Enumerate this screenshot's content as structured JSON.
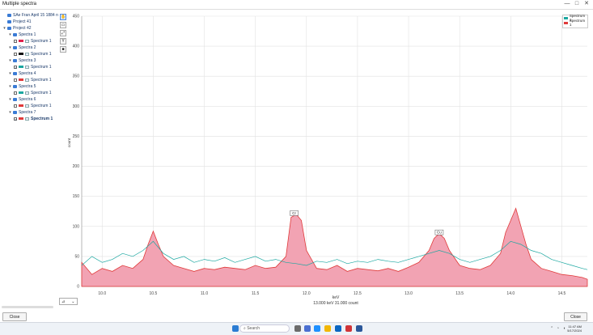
{
  "window": {
    "title": "Multiple spectra",
    "min": "—",
    "max": "□",
    "close": "✕"
  },
  "tree": [
    {
      "label": "SAe Fran April 15 1884 n",
      "level": 0,
      "type": "folder",
      "expander": ""
    },
    {
      "label": "Project 41",
      "level": 0,
      "type": "folder",
      "expander": ""
    },
    {
      "label": "Project 42",
      "level": 0,
      "type": "folder",
      "expander": "▾"
    },
    {
      "label": "Spectra 1",
      "level": 1,
      "type": "folder",
      "expander": "▾"
    },
    {
      "label": "Spectrum 1",
      "level": 2,
      "type": "spectrum",
      "checked": false,
      "color": "#e0204a"
    },
    {
      "label": "Spectra 2",
      "level": 1,
      "type": "folder",
      "expander": "▾"
    },
    {
      "label": "Spectrum 1",
      "level": 2,
      "type": "spectrum",
      "checked": false,
      "color": "#111111"
    },
    {
      "label": "Spectra 3",
      "level": 1,
      "type": "folder",
      "expander": "▾"
    },
    {
      "label": "Spectrum 1",
      "level": 2,
      "type": "spectrum",
      "checked": true,
      "color": "#1aa7a0"
    },
    {
      "label": "Spectra 4",
      "level": 1,
      "type": "folder",
      "expander": "▾"
    },
    {
      "label": "Spectrum 1",
      "level": 2,
      "type": "spectrum",
      "checked": false,
      "color": "#e03a3a"
    },
    {
      "label": "Spectra 5",
      "level": 1,
      "type": "folder",
      "expander": "▾"
    },
    {
      "label": "Spectrum 1",
      "level": 2,
      "type": "spectrum",
      "checked": false,
      "color": "#1aa7a0"
    },
    {
      "label": "Spectra 6",
      "level": 1,
      "type": "folder",
      "expander": "▾"
    },
    {
      "label": "Spectrum 1",
      "level": 2,
      "type": "spectrum",
      "checked": false,
      "color": "#e03a3a"
    },
    {
      "label": "Spectra 7",
      "level": 1,
      "type": "folder",
      "expander": "▾"
    },
    {
      "label": "Spectrum 1",
      "level": 2,
      "type": "spectrum",
      "checked": true,
      "color": "#e03a3a",
      "bold": true
    }
  ],
  "buttons": {
    "close_left": "Close",
    "close_right": "Close"
  },
  "tools": [
    "hand-icon",
    "zoom-box-icon",
    "zoom-fit-icon",
    "label-icon",
    "screenshot-icon"
  ],
  "plot": {
    "xlabel": "keV",
    "ylabel": "count",
    "readout": "13.000 keV  31.000 count",
    "legend": [
      {
        "name": "Spectrum 1",
        "color": "#1aa7a0"
      },
      {
        "name": "Spectrum 1",
        "color": "#e03a3a"
      }
    ],
    "peak_labels": [
      {
        "text": "Cr",
        "x": 11.88,
        "y": 118
      },
      {
        "text": "Cu",
        "x": 13.3,
        "y": 86
      }
    ]
  },
  "chart_data": {
    "type": "area",
    "xlabel": "keV",
    "ylabel": "count",
    "xlim": [
      9.8,
      14.75
    ],
    "ylim": [
      0,
      450
    ],
    "xticks": [
      10.0,
      10.5,
      11.0,
      11.5,
      12.0,
      12.5,
      13.0,
      13.5,
      14.0,
      14.5
    ],
    "xtick_labels": [
      "10.0",
      "10.5",
      "11.0",
      "11.5",
      "12.0",
      "12.5",
      "13.0",
      "13.5",
      "14.0",
      "14.5"
    ],
    "yticks": [
      0,
      50,
      100,
      150,
      200,
      250,
      300,
      350,
      400,
      450
    ],
    "ytick_labels": [
      "0",
      "50",
      "100",
      "150",
      "200",
      "250",
      "300",
      "350",
      "400",
      "450"
    ],
    "grid": true,
    "legend_position": "top-right",
    "series": [
      {
        "name": "Spectrum 1",
        "color": "#e03a3a",
        "fill": "#f2a3b3",
        "x": [
          9.8,
          9.9,
          10.0,
          10.1,
          10.2,
          10.3,
          10.4,
          10.45,
          10.5,
          10.55,
          10.6,
          10.7,
          10.8,
          10.9,
          11.0,
          11.1,
          11.2,
          11.3,
          11.4,
          11.5,
          11.6,
          11.7,
          11.8,
          11.85,
          11.9,
          11.95,
          12.0,
          12.1,
          12.2,
          12.3,
          12.4,
          12.5,
          12.6,
          12.7,
          12.8,
          12.9,
          13.0,
          13.1,
          13.2,
          13.25,
          13.3,
          13.35,
          13.4,
          13.5,
          13.6,
          13.7,
          13.8,
          13.9,
          13.95,
          14.0,
          14.05,
          14.1,
          14.15,
          14.2,
          14.3,
          14.4,
          14.5,
          14.6,
          14.7,
          14.75
        ],
        "y": [
          40,
          20,
          30,
          25,
          35,
          30,
          45,
          70,
          92,
          70,
          50,
          35,
          30,
          25,
          30,
          28,
          32,
          30,
          28,
          35,
          30,
          32,
          50,
          115,
          120,
          110,
          60,
          30,
          28,
          35,
          25,
          30,
          28,
          26,
          30,
          25,
          32,
          40,
          60,
          80,
          88,
          80,
          60,
          35,
          30,
          28,
          35,
          55,
          90,
          110,
          130,
          100,
          70,
          45,
          30,
          25,
          20,
          18,
          15,
          12
        ]
      },
      {
        "name": "Spectrum 1",
        "color": "#1aa7a0",
        "x": [
          9.8,
          9.9,
          10.0,
          10.1,
          10.2,
          10.3,
          10.4,
          10.5,
          10.6,
          10.7,
          10.8,
          10.9,
          11.0,
          11.1,
          11.2,
          11.3,
          11.4,
          11.5,
          11.6,
          11.7,
          11.8,
          11.9,
          12.0,
          12.1,
          12.2,
          12.3,
          12.4,
          12.5,
          12.6,
          12.7,
          12.8,
          12.9,
          13.0,
          13.1,
          13.2,
          13.3,
          13.4,
          13.5,
          13.6,
          13.7,
          13.8,
          13.9,
          14.0,
          14.1,
          14.2,
          14.3,
          14.4,
          14.5,
          14.6,
          14.7,
          14.75
        ],
        "y": [
          35,
          50,
          40,
          45,
          55,
          50,
          60,
          75,
          55,
          45,
          50,
          40,
          45,
          42,
          48,
          40,
          45,
          50,
          42,
          45,
          40,
          38,
          35,
          42,
          40,
          45,
          38,
          42,
          40,
          45,
          42,
          40,
          45,
          50,
          55,
          60,
          55,
          45,
          40,
          45,
          50,
          60,
          75,
          70,
          60,
          55,
          45,
          40,
          35,
          30,
          28
        ]
      }
    ]
  },
  "taskbar": {
    "search_placeholder": "Search",
    "time": "11:47 AM",
    "date": "5/17/2024"
  }
}
